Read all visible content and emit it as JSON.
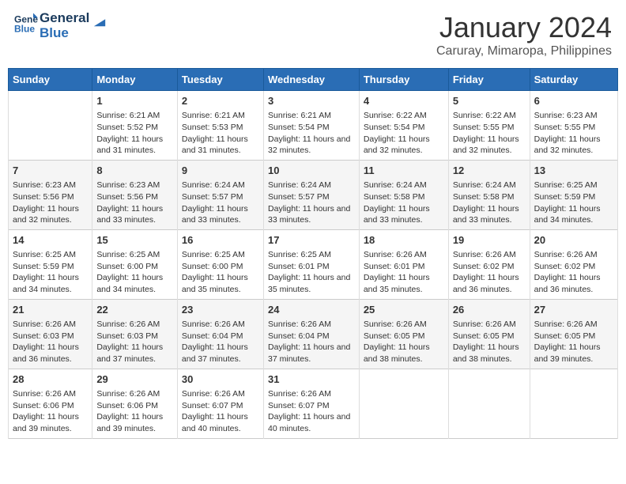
{
  "header": {
    "logo_line1": "General",
    "logo_line2": "Blue",
    "month_year": "January 2024",
    "location": "Caruray, Mimaropa, Philippines"
  },
  "columns": [
    "Sunday",
    "Monday",
    "Tuesday",
    "Wednesday",
    "Thursday",
    "Friday",
    "Saturday"
  ],
  "weeks": [
    [
      {
        "day": "",
        "sunrise": "",
        "sunset": "",
        "daylight": ""
      },
      {
        "day": "1",
        "sunrise": "Sunrise: 6:21 AM",
        "sunset": "Sunset: 5:52 PM",
        "daylight": "Daylight: 11 hours and 31 minutes."
      },
      {
        "day": "2",
        "sunrise": "Sunrise: 6:21 AM",
        "sunset": "Sunset: 5:53 PM",
        "daylight": "Daylight: 11 hours and 31 minutes."
      },
      {
        "day": "3",
        "sunrise": "Sunrise: 6:21 AM",
        "sunset": "Sunset: 5:54 PM",
        "daylight": "Daylight: 11 hours and 32 minutes."
      },
      {
        "day": "4",
        "sunrise": "Sunrise: 6:22 AM",
        "sunset": "Sunset: 5:54 PM",
        "daylight": "Daylight: 11 hours and 32 minutes."
      },
      {
        "day": "5",
        "sunrise": "Sunrise: 6:22 AM",
        "sunset": "Sunset: 5:55 PM",
        "daylight": "Daylight: 11 hours and 32 minutes."
      },
      {
        "day": "6",
        "sunrise": "Sunrise: 6:23 AM",
        "sunset": "Sunset: 5:55 PM",
        "daylight": "Daylight: 11 hours and 32 minutes."
      }
    ],
    [
      {
        "day": "7",
        "sunrise": "Sunrise: 6:23 AM",
        "sunset": "Sunset: 5:56 PM",
        "daylight": "Daylight: 11 hours and 32 minutes."
      },
      {
        "day": "8",
        "sunrise": "Sunrise: 6:23 AM",
        "sunset": "Sunset: 5:56 PM",
        "daylight": "Daylight: 11 hours and 33 minutes."
      },
      {
        "day": "9",
        "sunrise": "Sunrise: 6:24 AM",
        "sunset": "Sunset: 5:57 PM",
        "daylight": "Daylight: 11 hours and 33 minutes."
      },
      {
        "day": "10",
        "sunrise": "Sunrise: 6:24 AM",
        "sunset": "Sunset: 5:57 PM",
        "daylight": "Daylight: 11 hours and 33 minutes."
      },
      {
        "day": "11",
        "sunrise": "Sunrise: 6:24 AM",
        "sunset": "Sunset: 5:58 PM",
        "daylight": "Daylight: 11 hours and 33 minutes."
      },
      {
        "day": "12",
        "sunrise": "Sunrise: 6:24 AM",
        "sunset": "Sunset: 5:58 PM",
        "daylight": "Daylight: 11 hours and 33 minutes."
      },
      {
        "day": "13",
        "sunrise": "Sunrise: 6:25 AM",
        "sunset": "Sunset: 5:59 PM",
        "daylight": "Daylight: 11 hours and 34 minutes."
      }
    ],
    [
      {
        "day": "14",
        "sunrise": "Sunrise: 6:25 AM",
        "sunset": "Sunset: 5:59 PM",
        "daylight": "Daylight: 11 hours and 34 minutes."
      },
      {
        "day": "15",
        "sunrise": "Sunrise: 6:25 AM",
        "sunset": "Sunset: 6:00 PM",
        "daylight": "Daylight: 11 hours and 34 minutes."
      },
      {
        "day": "16",
        "sunrise": "Sunrise: 6:25 AM",
        "sunset": "Sunset: 6:00 PM",
        "daylight": "Daylight: 11 hours and 35 minutes."
      },
      {
        "day": "17",
        "sunrise": "Sunrise: 6:25 AM",
        "sunset": "Sunset: 6:01 PM",
        "daylight": "Daylight: 11 hours and 35 minutes."
      },
      {
        "day": "18",
        "sunrise": "Sunrise: 6:26 AM",
        "sunset": "Sunset: 6:01 PM",
        "daylight": "Daylight: 11 hours and 35 minutes."
      },
      {
        "day": "19",
        "sunrise": "Sunrise: 6:26 AM",
        "sunset": "Sunset: 6:02 PM",
        "daylight": "Daylight: 11 hours and 36 minutes."
      },
      {
        "day": "20",
        "sunrise": "Sunrise: 6:26 AM",
        "sunset": "Sunset: 6:02 PM",
        "daylight": "Daylight: 11 hours and 36 minutes."
      }
    ],
    [
      {
        "day": "21",
        "sunrise": "Sunrise: 6:26 AM",
        "sunset": "Sunset: 6:03 PM",
        "daylight": "Daylight: 11 hours and 36 minutes."
      },
      {
        "day": "22",
        "sunrise": "Sunrise: 6:26 AM",
        "sunset": "Sunset: 6:03 PM",
        "daylight": "Daylight: 11 hours and 37 minutes."
      },
      {
        "day": "23",
        "sunrise": "Sunrise: 6:26 AM",
        "sunset": "Sunset: 6:04 PM",
        "daylight": "Daylight: 11 hours and 37 minutes."
      },
      {
        "day": "24",
        "sunrise": "Sunrise: 6:26 AM",
        "sunset": "Sunset: 6:04 PM",
        "daylight": "Daylight: 11 hours and 37 minutes."
      },
      {
        "day": "25",
        "sunrise": "Sunrise: 6:26 AM",
        "sunset": "Sunset: 6:05 PM",
        "daylight": "Daylight: 11 hours and 38 minutes."
      },
      {
        "day": "26",
        "sunrise": "Sunrise: 6:26 AM",
        "sunset": "Sunset: 6:05 PM",
        "daylight": "Daylight: 11 hours and 38 minutes."
      },
      {
        "day": "27",
        "sunrise": "Sunrise: 6:26 AM",
        "sunset": "Sunset: 6:05 PM",
        "daylight": "Daylight: 11 hours and 39 minutes."
      }
    ],
    [
      {
        "day": "28",
        "sunrise": "Sunrise: 6:26 AM",
        "sunset": "Sunset: 6:06 PM",
        "daylight": "Daylight: 11 hours and 39 minutes."
      },
      {
        "day": "29",
        "sunrise": "Sunrise: 6:26 AM",
        "sunset": "Sunset: 6:06 PM",
        "daylight": "Daylight: 11 hours and 39 minutes."
      },
      {
        "day": "30",
        "sunrise": "Sunrise: 6:26 AM",
        "sunset": "Sunset: 6:07 PM",
        "daylight": "Daylight: 11 hours and 40 minutes."
      },
      {
        "day": "31",
        "sunrise": "Sunrise: 6:26 AM",
        "sunset": "Sunset: 6:07 PM",
        "daylight": "Daylight: 11 hours and 40 minutes."
      },
      {
        "day": "",
        "sunrise": "",
        "sunset": "",
        "daylight": ""
      },
      {
        "day": "",
        "sunrise": "",
        "sunset": "",
        "daylight": ""
      },
      {
        "day": "",
        "sunrise": "",
        "sunset": "",
        "daylight": ""
      }
    ]
  ]
}
